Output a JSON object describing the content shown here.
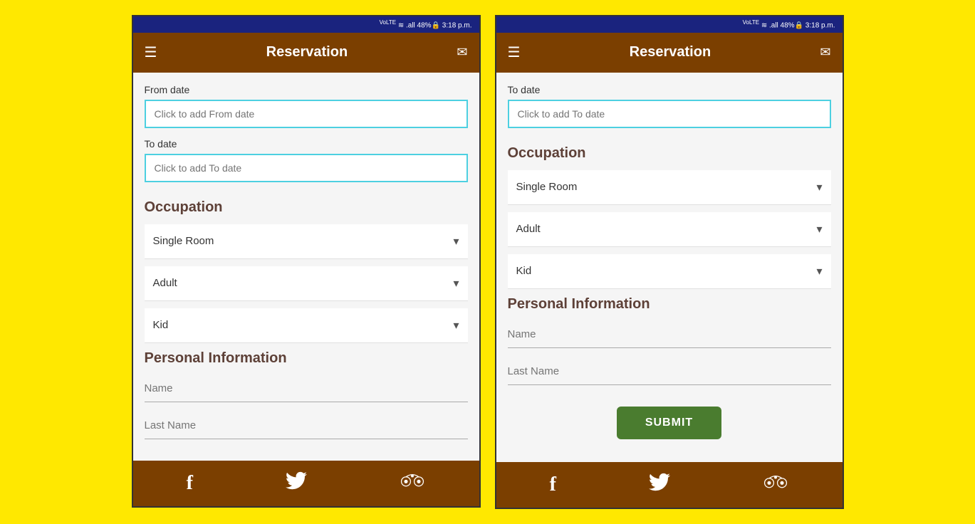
{
  "left_phone": {
    "status_bar": "VoLTE ≋ .all 48% 🔒 3:18 p.m.",
    "app_bar": {
      "title": "Reservation",
      "menu_icon": "☰",
      "mail_icon": "✉"
    },
    "from_date_label": "From date",
    "from_date_placeholder": "Click to add From date",
    "to_date_label": "To date",
    "to_date_placeholder": "Click to add To date",
    "occupation_heading": "Occupation",
    "dropdowns": [
      {
        "label": "Single Room"
      },
      {
        "label": "Adult"
      },
      {
        "label": "Kid"
      }
    ],
    "personal_info_heading": "Personal Information",
    "name_placeholder": "Name",
    "lastname_placeholder": "Last Name",
    "bottom_icons": [
      "facebook",
      "twitter",
      "tripadvisor"
    ]
  },
  "right_phone": {
    "status_bar": "VoLTE ≋ .all 48% 🔒 3:18 p.m.",
    "app_bar": {
      "title": "Reservation",
      "menu_icon": "☰",
      "mail_icon": "✉"
    },
    "to_date_label": "To date",
    "to_date_placeholder": "Click to add To date",
    "occupation_heading": "Occupation",
    "dropdowns": [
      {
        "label": "Single Room"
      },
      {
        "label": "Adult"
      },
      {
        "label": "Kid"
      }
    ],
    "personal_info_heading": "Personal Information",
    "name_placeholder": "Name",
    "lastname_placeholder": "Last Name",
    "submit_label": "SUBMIT",
    "bottom_icons": [
      "facebook",
      "twitter",
      "tripadvisor"
    ]
  }
}
